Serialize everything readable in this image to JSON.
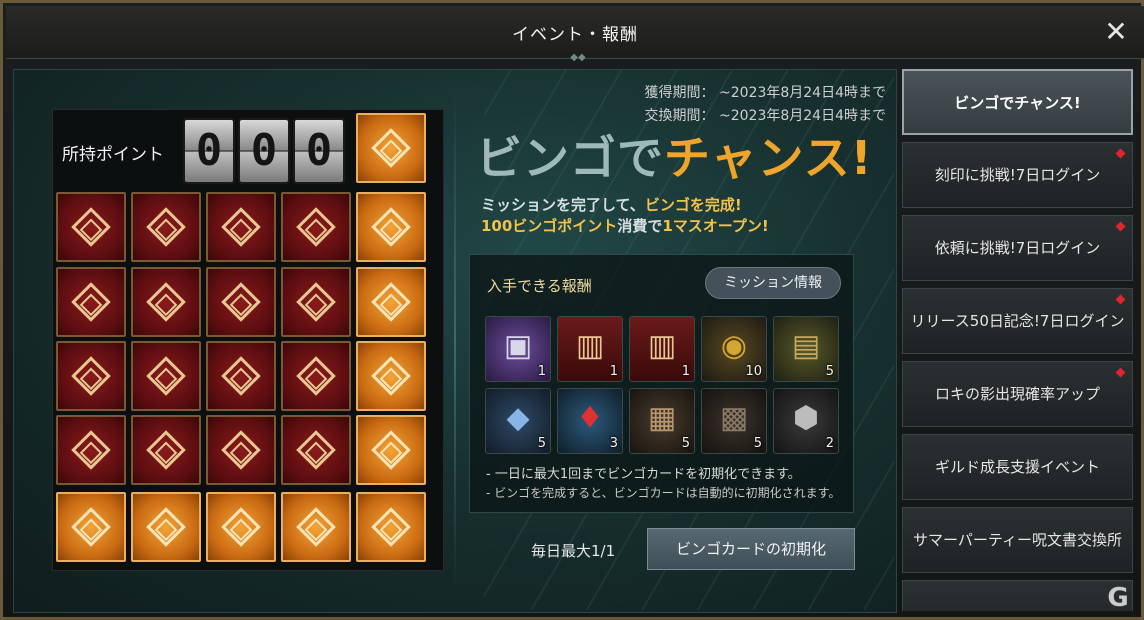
{
  "window": {
    "title": "イベント・報酬",
    "close_icon": "close-icon"
  },
  "board": {
    "points_label": "所持ポイント",
    "digits": [
      "0",
      "0",
      "0"
    ],
    "rows": [
      [
        "gold"
      ],
      [
        "red",
        "red",
        "red",
        "red",
        "gold"
      ],
      [
        "red",
        "red",
        "red",
        "red",
        "gold"
      ],
      [
        "red",
        "red",
        "red",
        "red",
        "gold"
      ],
      [
        "red",
        "red",
        "red",
        "red",
        "gold"
      ],
      [
        "gold",
        "gold",
        "gold",
        "gold",
        "gold"
      ]
    ]
  },
  "event": {
    "acquire_period": "獲得期間： ~2023年8月24日4時まで",
    "exchange_period": "交換期間： ~2023年8月24日4時まで",
    "headline_part1": "ビンゴで",
    "headline_part2": "チャンス!",
    "desc1_a": "ミッションを完了して、",
    "desc1_b": "ビンゴを完成!",
    "desc2_a": "100ビンゴポイント",
    "desc2_b": "消費で",
    "desc2_c": "1マスオープン!"
  },
  "rewards": {
    "title": "入手できる報酬",
    "mission_button": "ミッション情報",
    "items": [
      {
        "icon": "chest-icon",
        "count": "1"
      },
      {
        "icon": "card-pack-icon",
        "count": "1"
      },
      {
        "icon": "card-pack-icon",
        "count": "1"
      },
      {
        "icon": "coin-icon",
        "count": "10"
      },
      {
        "icon": "treasure-box-icon",
        "count": "5"
      },
      {
        "icon": "crystal-icon",
        "count": "5"
      },
      {
        "icon": "potion-icon",
        "count": "3"
      },
      {
        "icon": "basket-icon",
        "count": "5"
      },
      {
        "icon": "wooden-chest-icon",
        "count": "5"
      },
      {
        "icon": "ore-icon",
        "count": "2"
      }
    ],
    "note1": "- 一日に最大1回までビンゴカードを初期化できます。",
    "note2": "- ビンゴを完成すると、ビンゴカードは自動的に初期化されます。"
  },
  "footer": {
    "daily_limit": "毎日最大1/1",
    "reset_button": "ビンゴカードの初期化"
  },
  "sidebar": {
    "tabs": [
      {
        "label": "ビンゴでチャンス!",
        "active": true,
        "badge": false
      },
      {
        "label": "刻印に挑戦!7日ログイン",
        "active": false,
        "badge": true
      },
      {
        "label": "依頼に挑戦!7日ログイン",
        "active": false,
        "badge": true
      },
      {
        "label": "リリース50日記念!7日ログイン",
        "active": false,
        "badge": true
      },
      {
        "label": "ロキの影出現確率アップ",
        "active": false,
        "badge": true
      },
      {
        "label": "ギルド成長支援イベント",
        "active": false,
        "badge": false
      },
      {
        "label": "サマーパーティー呪文書交換所",
        "active": false,
        "badge": false
      }
    ]
  },
  "colors": {
    "accent_gold": "#f0a52a",
    "badge_red": "#e0262c",
    "panel_teal": "#17302f"
  }
}
